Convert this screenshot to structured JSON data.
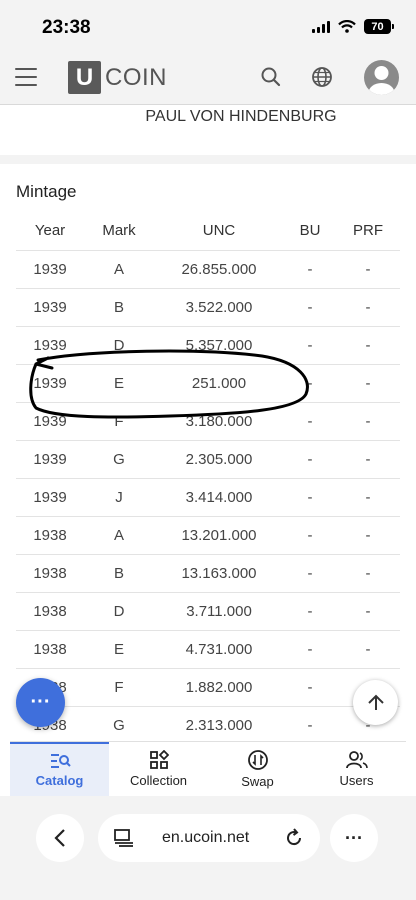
{
  "status_bar": {
    "time": "23:38",
    "battery": "70"
  },
  "header": {
    "logo_letter": "U",
    "logo_text": "COIN"
  },
  "coin": {
    "issuer_line": "PAUL VON HINDENBURG"
  },
  "mintage": {
    "title": "Mintage",
    "columns": [
      "Year",
      "Mark",
      "UNC",
      "BU",
      "PRF"
    ],
    "rows": [
      [
        "1939",
        "A",
        "26.855.000",
        "-",
        "-"
      ],
      [
        "1939",
        "B",
        "3.522.000",
        "-",
        "-"
      ],
      [
        "1939",
        "D",
        "5.357.000",
        "-",
        "-"
      ],
      [
        "1939",
        "E",
        "251.000",
        "-",
        "-"
      ],
      [
        "1939",
        "F",
        "3.180.000",
        "-",
        "-"
      ],
      [
        "1939",
        "G",
        "2.305.000",
        "-",
        "-"
      ],
      [
        "1939",
        "J",
        "3.414.000",
        "-",
        "-"
      ],
      [
        "1938",
        "A",
        "13.201.000",
        "-",
        "-"
      ],
      [
        "1938",
        "B",
        "13.163.000",
        "-",
        "-"
      ],
      [
        "1938",
        "D",
        "3.711.000",
        "-",
        "-"
      ],
      [
        "1938",
        "E",
        "4.731.000",
        "-",
        "-"
      ],
      [
        "1938",
        "F",
        "1.882.000",
        "-",
        "-"
      ],
      [
        "1938",
        "G",
        "2.313.000",
        "-",
        "-"
      ]
    ]
  },
  "fab": {
    "more_label": "···"
  },
  "bottom_nav": {
    "items": [
      {
        "label": "Catalog",
        "icon": "catalog-icon",
        "active": true
      },
      {
        "label": "Collection",
        "icon": "collection-icon",
        "active": false
      },
      {
        "label": "Swap",
        "icon": "swap-icon",
        "active": false
      },
      {
        "label": "Users",
        "icon": "users-icon",
        "active": false
      }
    ]
  },
  "browser": {
    "url": "en.ucoin.net",
    "more_label": "···"
  },
  "colors": {
    "accent": "#3f6fdc",
    "header_bg": "#f3f3f3",
    "scribble": "#000000"
  }
}
